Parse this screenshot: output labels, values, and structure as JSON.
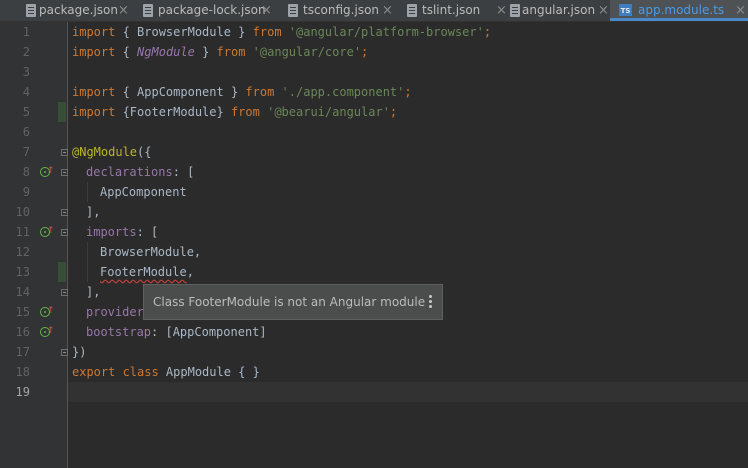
{
  "tabs": [
    {
      "label": "package.json",
      "icon": "json-file-icon",
      "active": false
    },
    {
      "label": "package-lock.json",
      "icon": "json-file-icon",
      "active": false
    },
    {
      "label": "tsconfig.json",
      "icon": "json-file-icon",
      "active": false
    },
    {
      "label": "tslint.json",
      "icon": "json-file-icon",
      "active": false
    },
    {
      "label": "angular.json",
      "icon": "json-file-icon",
      "active": false
    },
    {
      "label": "app.module.ts",
      "icon": "typescript-file-icon",
      "active": true
    }
  ],
  "tab_close_glyph": "×",
  "ts_badge": "TS",
  "line_numbers": [
    "1",
    "2",
    "3",
    "4",
    "5",
    "6",
    "7",
    "8",
    "9",
    "10",
    "11",
    "12",
    "13",
    "14",
    "15",
    "16",
    "17",
    "18",
    "19"
  ],
  "code": {
    "l1": {
      "k1": "import",
      "t1": " { BrowserModule } ",
      "k2": "from",
      "t2": " ",
      "s1": "'@angular/platform-browser'",
      "k3": ";"
    },
    "l2": {
      "k1": "import",
      "t1": " { ",
      "ng": "NgModule",
      "t2": " } ",
      "k2": "from",
      "t3": " ",
      "s1": "'@angular/core'",
      "k3": ";"
    },
    "l4": {
      "k1": "import",
      "t1": " { AppComponent } ",
      "k2": "from",
      "t2": " ",
      "s1": "'./app.component'",
      "k3": ";"
    },
    "l5": {
      "k1": "import",
      "t1": " {FooterModule} ",
      "k2": "from",
      "t2": " ",
      "s1": "'@bearui/angular'",
      "k3": ";"
    },
    "l7": {
      "d": "@NgModule",
      "t": "({"
    },
    "l8": {
      "p": "declarations",
      "t": ": ["
    },
    "l9": {
      "t": "AppComponent"
    },
    "l10": {
      "t": "],"
    },
    "l11": {
      "p": "imports",
      "t": ": ["
    },
    "l12": {
      "t": "BrowserModule,"
    },
    "l13": {
      "t": "FooterModule",
      "t2": ","
    },
    "l14": {
      "t": "],"
    },
    "l15": {
      "p": "provider"
    },
    "l16": {
      "p": "bootstrap",
      "t": ": [AppComponent]"
    },
    "l17": {
      "t": "})"
    },
    "l18": {
      "k1": "export class",
      "t": " AppModule { }"
    }
  },
  "tooltip": {
    "message": "Class FooterModule is not an Angular module"
  }
}
